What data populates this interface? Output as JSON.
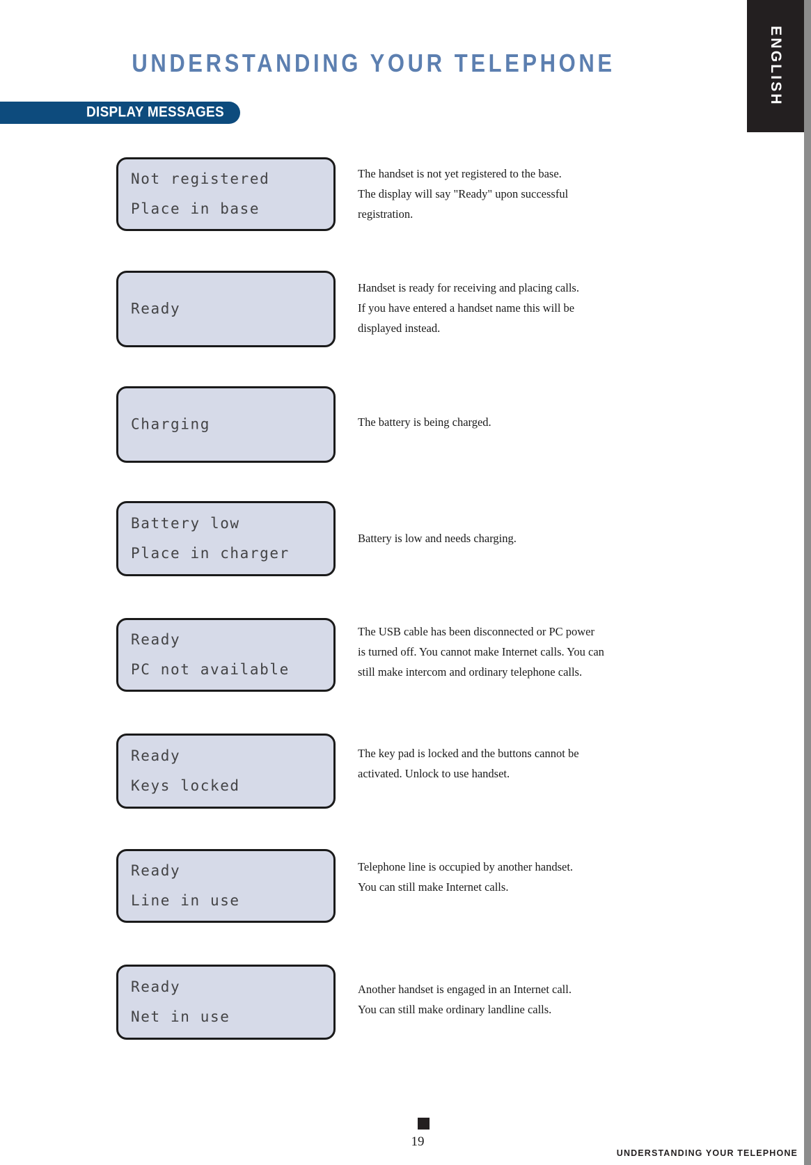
{
  "language_tab": {
    "label": "ENGLISH"
  },
  "header": {
    "title": "UNDERSTANDING YOUR TELEPHONE"
  },
  "section": {
    "banner_label": "DISPLAY MESSAGES"
  },
  "colors": {
    "title_blue": "#5c7fb0",
    "banner_navy": "#0d4b7d",
    "lcd_fill": "#d6dae8",
    "lcd_border": "#1a1a1a",
    "tab_black": "#231f20",
    "right_strip_gray": "#8c8c8c"
  },
  "messages": [
    {
      "display_lines": [
        "Not registered",
        "Place in base"
      ],
      "description_lines": [
        "The handset is not yet registered to the base.",
        "The display will say \"Ready\" upon successful",
        "registration."
      ]
    },
    {
      "display_lines": [
        "Ready"
      ],
      "description_lines": [
        "Handset is ready for receiving and placing calls.",
        "If you have entered a handset name this will be",
        "displayed instead."
      ]
    },
    {
      "display_lines": [
        "Charging"
      ],
      "description_lines": [
        "The battery is being charged."
      ]
    },
    {
      "display_lines": [
        "Battery low",
        "Place in charger"
      ],
      "description_lines": [
        "Battery is low and needs charging."
      ]
    },
    {
      "display_lines": [
        "Ready",
        "PC not available"
      ],
      "description_lines": [
        "The USB cable has been disconnected or PC power",
        "is turned off. You cannot make Internet calls. You can",
        "still make intercom and ordinary telephone calls."
      ]
    },
    {
      "display_lines": [
        "Ready",
        "Keys locked"
      ],
      "description_lines": [
        "The key pad is locked and the buttons cannot be",
        "activated. Unlock to use handset."
      ]
    },
    {
      "display_lines": [
        "Ready",
        "Line in use"
      ],
      "description_lines": [
        "Telephone line is occupied by another handset.",
        "You can still make Internet calls."
      ]
    },
    {
      "display_lines": [
        "Ready",
        "Net in use"
      ],
      "description_lines": [
        "Another handset is engaged in an Internet call.",
        "You can still make ordinary landline calls."
      ]
    }
  ],
  "footer": {
    "page_number": "19",
    "running_title": "UNDERSTANDING YOUR TELEPHONE"
  }
}
